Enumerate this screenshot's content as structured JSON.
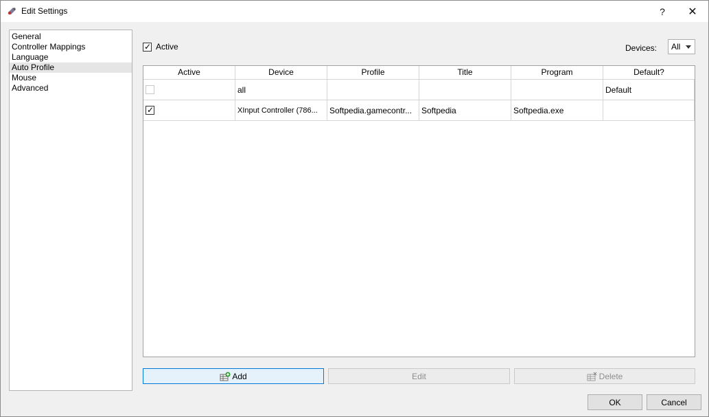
{
  "window": {
    "title": "Edit Settings",
    "help_label": "?",
    "close_label": "✕"
  },
  "sidebar": {
    "items": [
      {
        "label": "General"
      },
      {
        "label": "Controller Mappings"
      },
      {
        "label": "Language"
      },
      {
        "label": "Auto Profile",
        "selected": true
      },
      {
        "label": "Mouse"
      },
      {
        "label": "Advanced"
      }
    ]
  },
  "auto_profile": {
    "active_label": "Active",
    "active_checked": true,
    "devices_label": "Devices:",
    "devices_value": "All"
  },
  "table": {
    "columns": [
      "Active",
      "Device",
      "Profile",
      "Title",
      "Program",
      "Default?"
    ],
    "rows": [
      {
        "active": false,
        "device": "all",
        "profile": "",
        "title": "",
        "program": "",
        "default": "Default"
      },
      {
        "active": true,
        "device": "XInput Controller (786...",
        "profile": "Softpedia.gamecontr...",
        "title": "Softpedia",
        "program": "Softpedia.exe",
        "default": ""
      }
    ]
  },
  "buttons": {
    "add": "Add",
    "edit": "Edit",
    "delete": "Delete",
    "ok": "OK",
    "cancel": "Cancel"
  },
  "icons": {
    "app": "gamepad-icon",
    "add": "table-add-icon",
    "delete": "table-delete-icon",
    "check": "checkmark-icon"
  },
  "colors": {
    "focus_border": "#0078d7",
    "selection_bg": "#e5e5e5"
  }
}
